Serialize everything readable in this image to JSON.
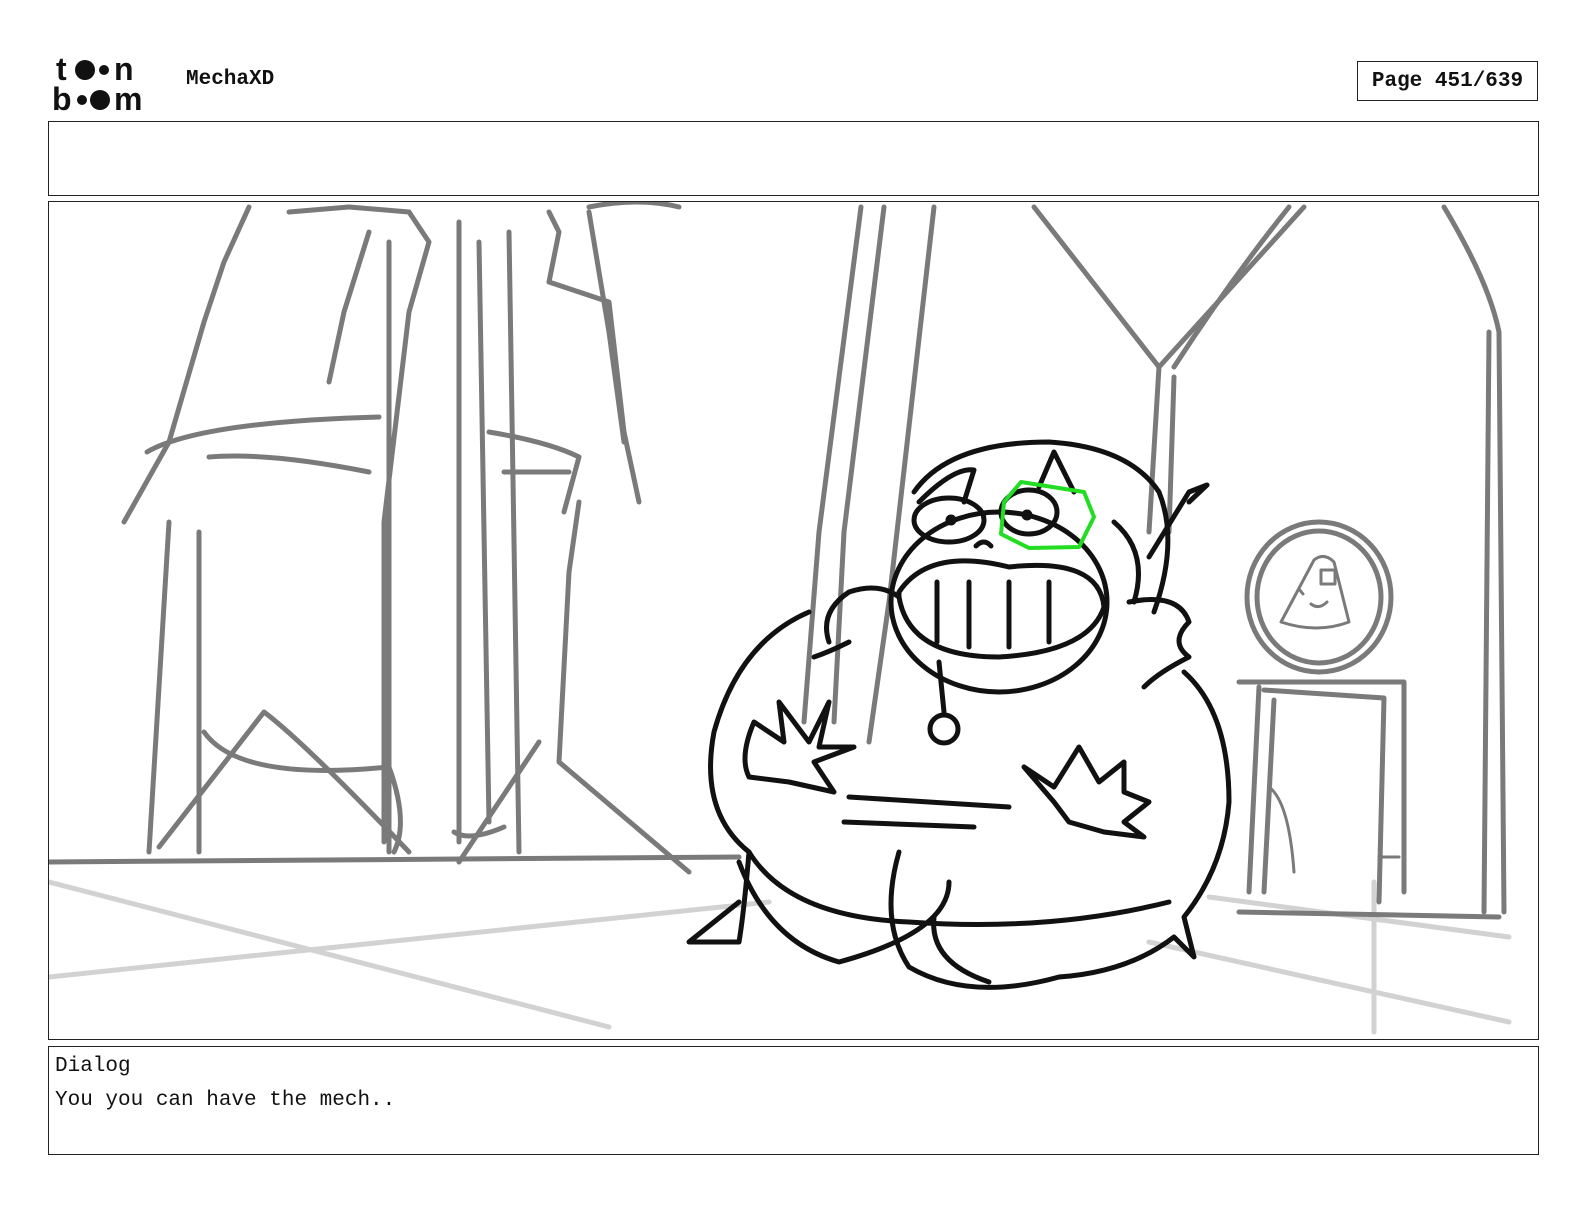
{
  "header": {
    "logo_name": "toon boom",
    "project_title": "MechaXD",
    "page_label": "Page 451/639"
  },
  "notes": {
    "text": ""
  },
  "panel": {
    "sketch_colors": {
      "background_lines": "#7a7a7a",
      "floor_lines": "#d2d2d2",
      "character_lines": "#111111",
      "highlight": "#22dd22"
    }
  },
  "dialog": {
    "label": "Dialog",
    "text": "You you can have the mech.."
  }
}
